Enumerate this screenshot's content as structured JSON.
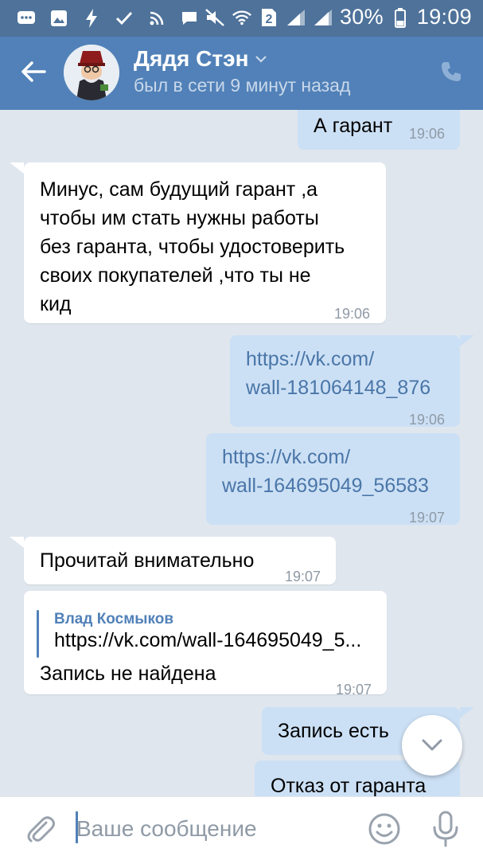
{
  "status_bar": {
    "battery": "30%",
    "time": "19:09",
    "sim": "2",
    "icons": [
      "messages-icon",
      "gallery-icon",
      "flash-icon",
      "check-icon",
      "rss-icon",
      "chat-icon",
      "mute-icon",
      "wifi-icon",
      "sim-icon",
      "signal-icon",
      "signal-icon",
      "battery-icon"
    ]
  },
  "header": {
    "contact_name": "Дядя Стэн",
    "status": "был в сети 9 минут назад"
  },
  "messages": [
    {
      "direction": "out",
      "text": "А гарант",
      "time": "19:06"
    },
    {
      "direction": "in",
      "lines": [
        "Минус, сам будущий гарант ,а",
        "чтобы им стать нужны работы",
        "без гаранта, чтобы удостоверить",
        "своих покупателей ,что ты не",
        "кид"
      ],
      "time": "19:06"
    },
    {
      "direction": "out",
      "lines": [
        "https://vk.com/",
        "wall-181064148_876"
      ],
      "time": "19:06"
    },
    {
      "direction": "out",
      "lines": [
        "https://vk.com/",
        "wall-164695049_56583"
      ],
      "time": "19:07"
    },
    {
      "direction": "in",
      "text": "Прочитай внимательно",
      "time": "19:07"
    },
    {
      "direction": "in",
      "forward_author": "Влад Космыков",
      "forward_text": "https://vk.com/wall-164695049_5...",
      "text": "Запись не найдена",
      "time": "19:07"
    },
    {
      "direction": "out",
      "text": "Запись есть"
    },
    {
      "direction": "out",
      "text": "Отказ от гаранта"
    }
  ],
  "composer": {
    "placeholder": "Ваше сообщение"
  },
  "colors": {
    "status_bar": "#4e729a",
    "header": "#5181b8",
    "chat_bg": "#dfe6ee",
    "outgoing_bubble": "#cce0f5",
    "incoming_bubble": "#ffffff",
    "link": "#4a76a8"
  }
}
